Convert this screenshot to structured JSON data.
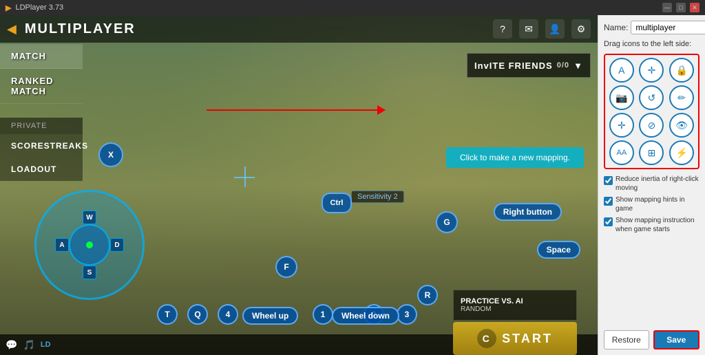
{
  "titlebar": {
    "logo": "▶",
    "title": "LDPlayer 3.73",
    "controls": [
      "—",
      "□",
      "✕"
    ]
  },
  "game": {
    "back_arrow": "◀",
    "title": "MULTIPLAYER",
    "top_icons": [
      "?",
      "✉",
      "👤",
      "⚙"
    ],
    "menu_items": [
      {
        "label": "MATCH",
        "active": true
      },
      {
        "label": "RANKED MATCH",
        "active": false
      }
    ],
    "private_label": "PRIVATE",
    "sub_menu": [
      {
        "label": "SCORESTREAKS"
      },
      {
        "label": "LOADOUT"
      }
    ],
    "invite_label": "InvITE FRIENDS",
    "invite_count": "0/0",
    "red_arrow_present": true,
    "mapping_hint": "Click to make a new mapping.",
    "sensitivity_label": "Sensitivity 2",
    "keys": {
      "x": "X",
      "ctrl": "Ctrl",
      "g": "G",
      "f": "F",
      "r": "R",
      "t": "T",
      "q": "Q",
      "four": "4",
      "one": "1",
      "two": "2",
      "three": "3",
      "right_button": "Right button",
      "space": "Space",
      "wheel_up": "Wheel up",
      "wheel_down": "Wheel down"
    }
  },
  "panel": {
    "name_label": "Name:",
    "name_value": "multiplayer",
    "drag_hint": "Drag icons to the left side:",
    "icons": [
      {
        "symbol": "A",
        "title": "keyboard-a"
      },
      {
        "symbol": "✛",
        "title": "crosshair"
      },
      {
        "symbol": "🔒",
        "title": "lock"
      },
      {
        "symbol": "📷",
        "title": "camera"
      },
      {
        "symbol": "↺",
        "title": "rotate"
      },
      {
        "symbol": "✏",
        "title": "pencil"
      },
      {
        "symbol": "✛",
        "title": "plus"
      },
      {
        "symbol": "⊘",
        "title": "cancel"
      },
      {
        "symbol": "👁",
        "title": "eye"
      },
      {
        "symbol": "AA",
        "title": "text-aa"
      },
      {
        "symbol": "⊞",
        "title": "grid"
      },
      {
        "symbol": "⚡",
        "title": "lightning"
      }
    ],
    "checkboxes": [
      {
        "label": "Reduce inertia of right-click moving",
        "checked": true
      },
      {
        "label": "Show mapping hints in game",
        "checked": true
      },
      {
        "label": "Show mapping instruction when game starts",
        "checked": true
      }
    ],
    "restore_label": "Restore",
    "save_label": "Save"
  },
  "bottom": {
    "chat_icon": "💬",
    "start_label": "START",
    "practice_title": "PRACTICE VS. AI",
    "practice_sub": "RANDOM"
  }
}
